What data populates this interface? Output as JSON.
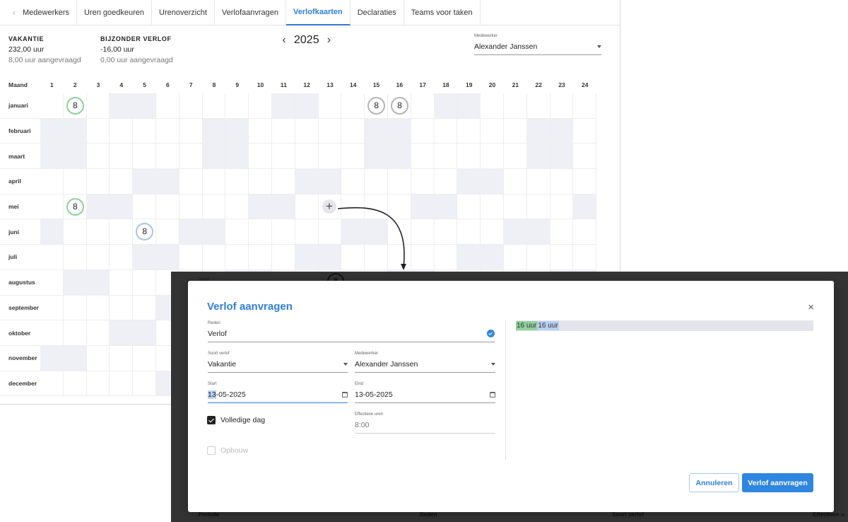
{
  "tabs": {
    "back_icon": "chevron-left-icon",
    "items": [
      {
        "label": "Medewerkers",
        "active": false
      },
      {
        "label": "Uren goedkeuren",
        "active": false
      },
      {
        "label": "Urenoverzicht",
        "active": false
      },
      {
        "label": "Verlofaanvragen",
        "active": false
      },
      {
        "label": "Verlofkaarten",
        "active": true
      },
      {
        "label": "Declaraties",
        "active": false
      },
      {
        "label": "Teams voor taken",
        "active": false
      }
    ]
  },
  "summary": {
    "vakantie": {
      "label": "VAKANTIE",
      "value": "232,00 uur",
      "requested": "8,00 uur aangevraagd"
    },
    "bijzonder": {
      "label": "BIJZONDER VERLOF",
      "value": "-16,00 uur",
      "requested": "0,00 uur aangevraagd"
    }
  },
  "year_nav": {
    "year": "2025",
    "prev": "‹",
    "next": "›"
  },
  "employee_filter": {
    "label": "Medewerker",
    "value": "Alexander Janssen"
  },
  "grid": {
    "month_header": "Maand",
    "days": [
      "1",
      "2",
      "3",
      "4",
      "5",
      "6",
      "7",
      "8",
      "9",
      "10",
      "11",
      "12",
      "13",
      "14",
      "15",
      "16",
      "17",
      "18",
      "19",
      "20",
      "21",
      "22",
      "23",
      "24"
    ],
    "months": [
      "januari",
      "februari",
      "maart",
      "april",
      "mei",
      "juni",
      "juli",
      "augustus",
      "september",
      "oktober",
      "november",
      "december"
    ],
    "entries": [
      {
        "month": 0,
        "day": 2,
        "hours": "8",
        "color": "green"
      },
      {
        "month": 0,
        "day": 15,
        "hours": "8",
        "color": "grey"
      },
      {
        "month": 0,
        "day": 16,
        "hours": "8",
        "color": "grey"
      },
      {
        "month": 4,
        "day": 2,
        "hours": "8",
        "color": "green"
      },
      {
        "month": 5,
        "day": 5,
        "hours": "8",
        "color": "blue"
      }
    ],
    "add_icon": "+"
  },
  "overlay_background": {
    "juni_label": "juni",
    "cell_value": "8",
    "columns": [
      "Periode",
      "Reden",
      "Soort verlof",
      "Effectieve u"
    ]
  },
  "modal": {
    "title": "Verlof aanvragen",
    "close_icon": "×",
    "reason": {
      "label": "Reden",
      "value": "Verlof"
    },
    "leave_type": {
      "label": "Soort verlof",
      "value": "Vakantie"
    },
    "employee": {
      "label": "Medewerker",
      "value": "Alexander Janssen"
    },
    "start": {
      "label": "Start",
      "value_highlight": "13",
      "value_rest": "-05-2025"
    },
    "end": {
      "label": "Eind",
      "value": "13-05-2025"
    },
    "full_day": {
      "label": "Volledige dag",
      "checked": true
    },
    "effective_hours": {
      "label": "Effectieve uren",
      "value": "8:00"
    },
    "accrual": {
      "label": "Opbouw",
      "checked": false
    },
    "hours_bar": {
      "part1": "16 uur",
      "part2": "16 uur"
    },
    "cancel_label": "Annuleren",
    "submit_label": "Verlof aanvragen"
  },
  "colors": {
    "accent": "#2f7fd6",
    "weekend": "#eff0f5",
    "overlay": "#333333",
    "green_circle": "#8bd19a",
    "blue_circle": "#a8c3e6"
  }
}
